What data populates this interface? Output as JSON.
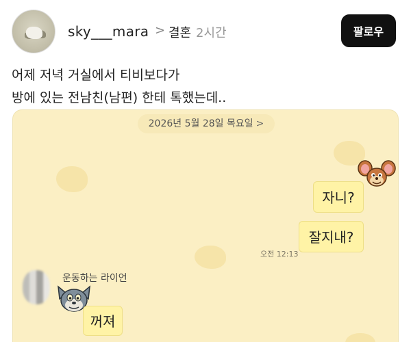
{
  "post": {
    "username": "sky___mara",
    "separator": ">",
    "category": "결혼",
    "time_ago": "2시간",
    "follow_label": "팔로우",
    "body_lines": [
      "어제 저녁 거실에서 티비보다가",
      "방에 있는 전남친(남편) 한테 톡했는데.."
    ]
  },
  "chat": {
    "date_label": "2026년 5월 28일 목요일",
    "date_arrow": ">",
    "messages_sent": [
      {
        "text": "자니?"
      },
      {
        "text": "잘지내?"
      }
    ],
    "sent_time": "오전 12:13",
    "reply_sender": "운동하는 라이언",
    "reply_text": "꺼져"
  },
  "colors": {
    "chat_background": "#fbefc4",
    "bubble": "#fff3a6",
    "follow_button": "#111111"
  }
}
